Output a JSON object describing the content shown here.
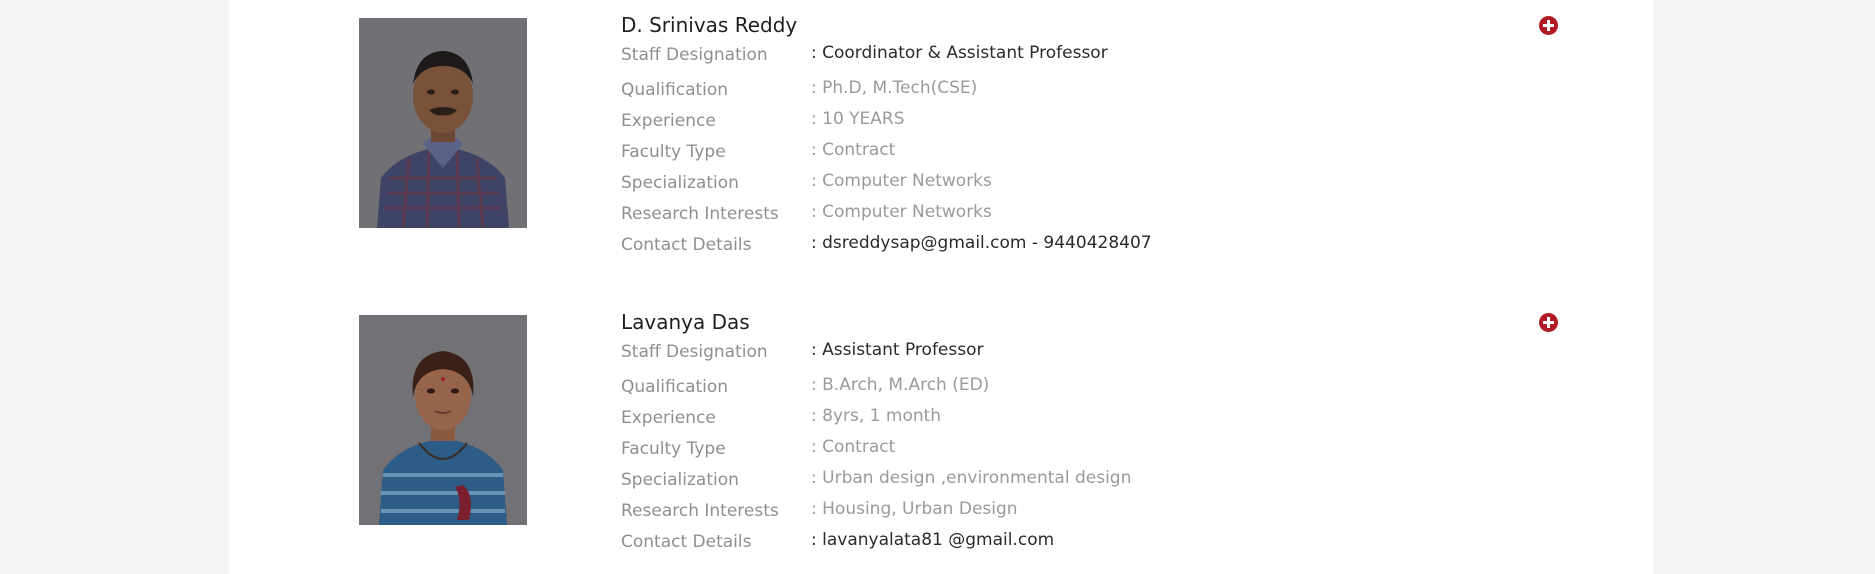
{
  "faculty": [
    {
      "name": "D. Srinivas Reddy",
      "photo": "faculty-photo-male",
      "fields": [
        {
          "label": "Staff Designation",
          "value": ": Coordinator & Assistant Professor",
          "emphasis": "dark"
        },
        {
          "label": "Qualification",
          "value": ": Ph.D, M.Tech(CSE)",
          "emphasis": "muted"
        },
        {
          "label": "Experience",
          "value": ": 10 YEARS",
          "emphasis": "muted"
        },
        {
          "label": "Faculty Type",
          "value": ": Contract",
          "emphasis": "muted"
        },
        {
          "label": "Specialization",
          "value": ": Computer Networks",
          "emphasis": "muted"
        },
        {
          "label": "Research Interests",
          "value": ": Computer Networks",
          "emphasis": "muted"
        },
        {
          "label": "Contact Details",
          "value": ": dsreddysap@gmail.com - 9440428407",
          "emphasis": "dark"
        }
      ],
      "expand_icon": "plus-circle-icon"
    },
    {
      "name": "Lavanya Das",
      "photo": "faculty-photo-female",
      "fields": [
        {
          "label": "Staff Designation",
          "value": ": Assistant Professor",
          "emphasis": "dark"
        },
        {
          "label": "Qualification",
          "value": ": B.Arch, M.Arch (ED)",
          "emphasis": "muted"
        },
        {
          "label": "Experience",
          "value": ": 8yrs, 1 month",
          "emphasis": "muted"
        },
        {
          "label": "Faculty Type",
          "value": ": Contract",
          "emphasis": "muted"
        },
        {
          "label": "Specialization",
          "value": ": Urban design ,environmental design",
          "emphasis": "muted"
        },
        {
          "label": "Research Interests",
          "value": ": Housing, Urban Design",
          "emphasis": "muted"
        },
        {
          "label": "Contact Details",
          "value": ": lavanyalata81 @gmail.com",
          "emphasis": "dark"
        }
      ],
      "expand_icon": "plus-circle-icon"
    }
  ],
  "colors": {
    "accent": "#b01a24",
    "label": "#8f8f8f",
    "value_muted": "#9a9a9a",
    "value_dark": "#2b2b2b",
    "page_background": "#f5f5f5",
    "panel_background": "#ffffff"
  }
}
